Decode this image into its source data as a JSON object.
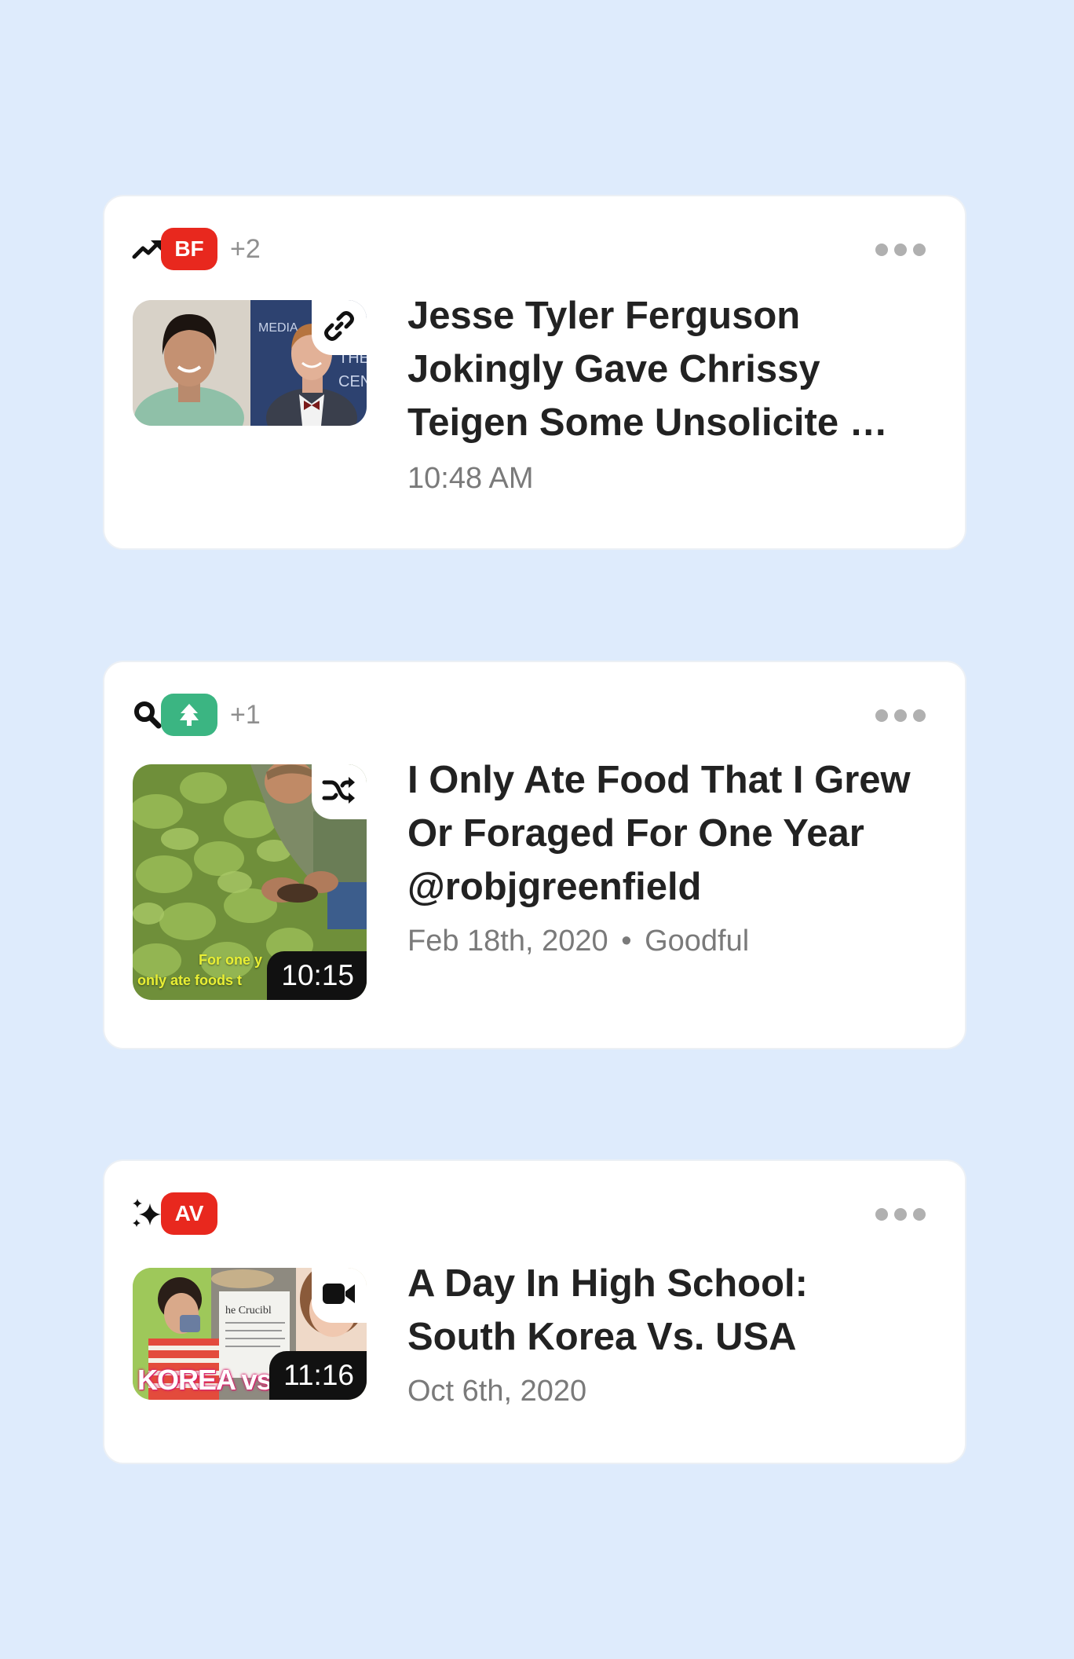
{
  "cards": [
    {
      "type_icon": "trending-up-icon",
      "badge": "BF",
      "badge_color": "#e8281e",
      "plus_count": "+2",
      "thumb_icon": "link-icon",
      "title": "Jesse Tyler Ferguson Jokingly Gave Chrissy Teigen Some Unsolicite …",
      "time": "10:48 AM"
    },
    {
      "type_icon": "search-icon",
      "badge_icon": "tree-icon",
      "badge_color": "#3bb582",
      "plus_count": "+1",
      "thumb_icon": "shuffle-icon",
      "thumb_caption_line1": "For one y",
      "thumb_caption_line2": "only ate foods t",
      "duration": "10:15",
      "title": "I Only Ate Food That I Grew Or Foraged For One Year @robjgreenfield",
      "date": "Feb 18th, 2020",
      "separator": "•",
      "source": "Goodful"
    },
    {
      "type_icon": "sparkle-icon",
      "badge": "AV",
      "badge_color": "#e8281e",
      "thumb_icon": "video-camera-icon",
      "thumb_caption": "KOREA vs",
      "duration": "11:16",
      "title": "A Day In High School: South Korea Vs. USA",
      "date": "Oct 6th, 2020"
    }
  ]
}
